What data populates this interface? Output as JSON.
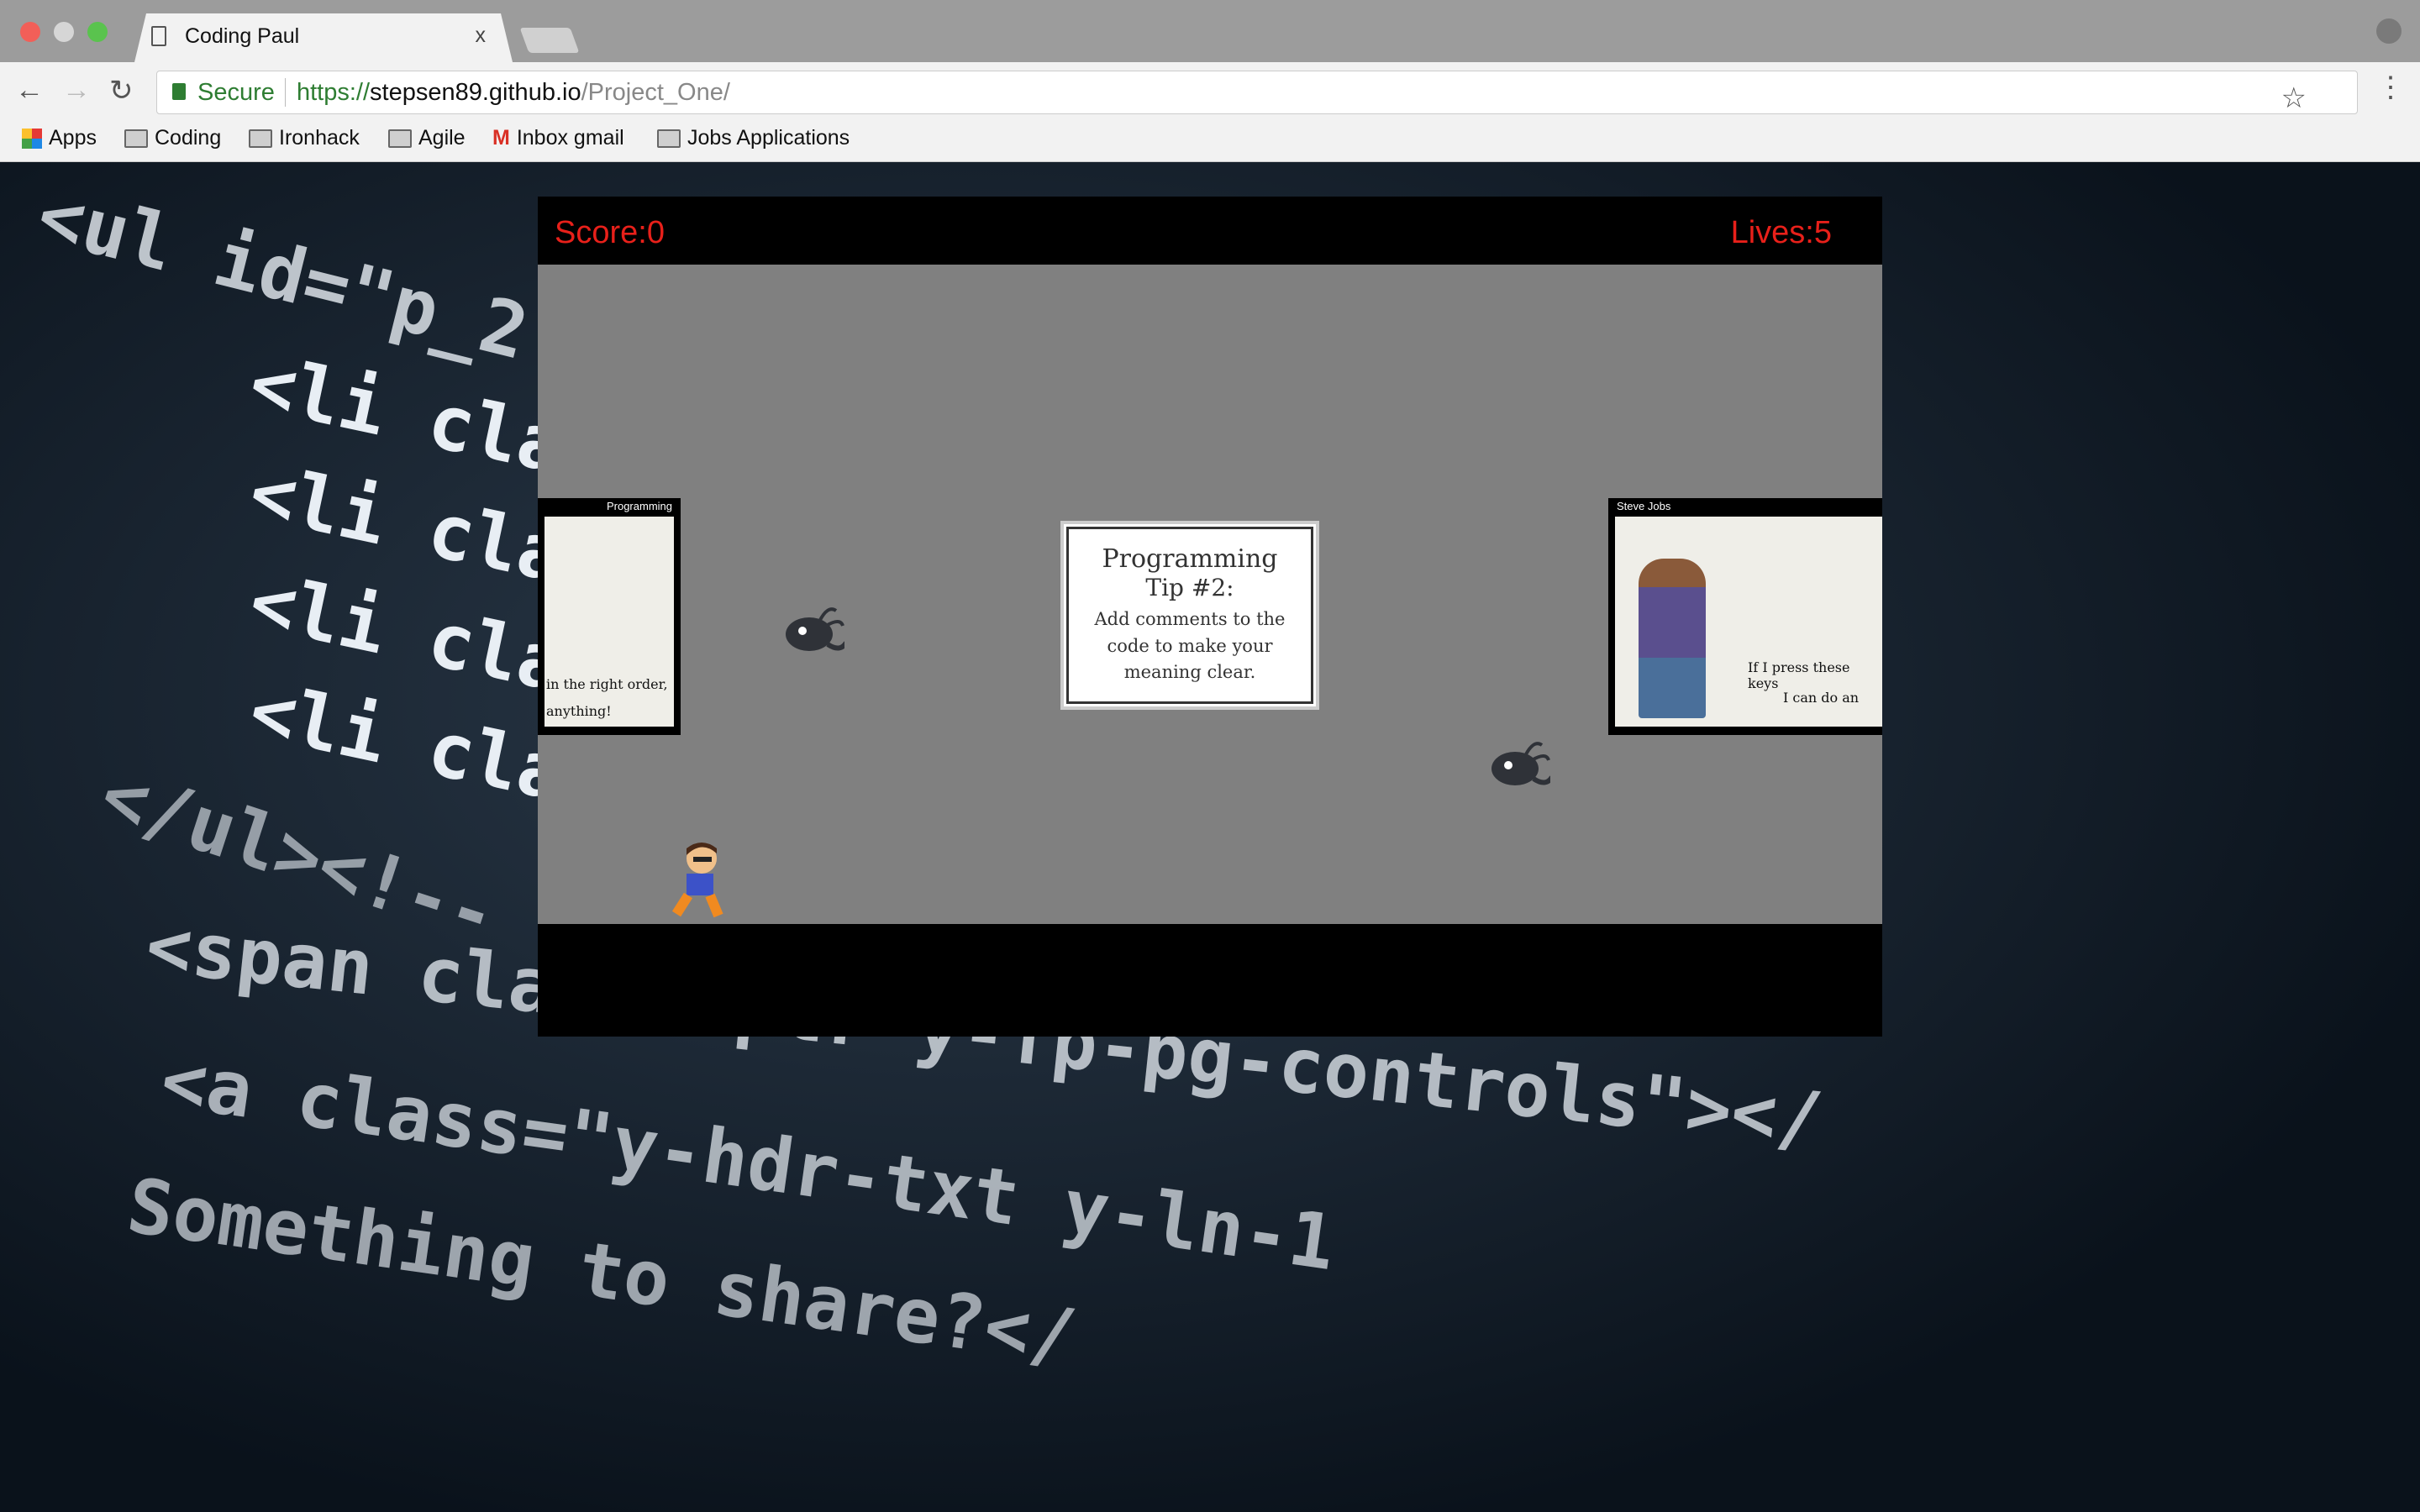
{
  "browser": {
    "tab_title": "Coding Paul",
    "tab_close": "x",
    "secure_label": "Secure",
    "url_scheme": "https://",
    "url_host": "stepsen89.github.io",
    "url_path": "/Project_One/",
    "bookmarks": [
      "Apps",
      "Coding",
      "Ironhack",
      "Agile",
      "Inbox gmail",
      "Jobs Applications"
    ]
  },
  "game": {
    "score_label": "Score:0",
    "lives_label": "Lives:5",
    "tip": {
      "title": "Programming",
      "number": "Tip #2:",
      "text": "Add comments to the code to make your meaning clear."
    },
    "left_comic": {
      "header": "Programming",
      "caption1": "in the right order,",
      "caption2": "anything!"
    },
    "right_comic": {
      "header": "Steve Jobs",
      "caption1": "If I press these keys",
      "caption2": "I can do an"
    }
  },
  "background_code": [
    "<ul id=\"p_2",
    "<li cla",
    "<li cla",
    "<li cla",
    "<li cla",
    "</ul><!--",
    "<span class=\"ptr y-fp-pg-controls\"></",
    "<a class=\"y-hdr-txt y-ln-1",
    "Something to share?</"
  ]
}
